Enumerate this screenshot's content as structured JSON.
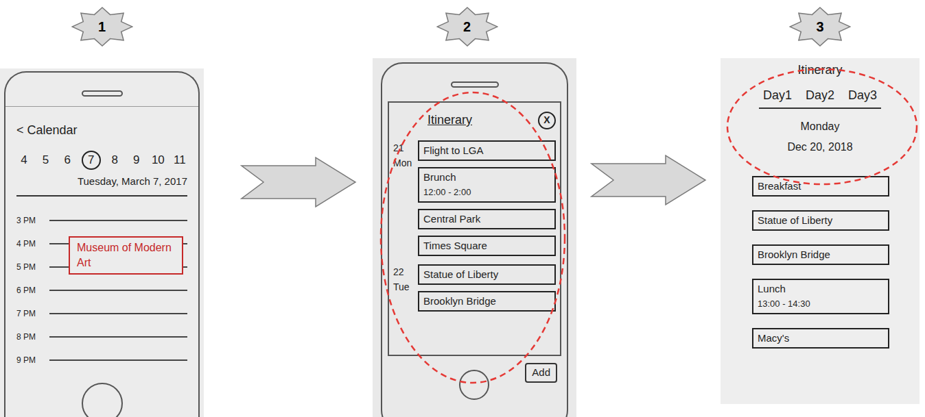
{
  "calendar_screen": {
    "badge": "1",
    "back": "< Calendar",
    "days": [
      {
        "label": "4",
        "selected": false
      },
      {
        "label": "5",
        "selected": false
      },
      {
        "label": "6",
        "selected": false
      },
      {
        "label": "7",
        "selected": true
      },
      {
        "label": "8",
        "selected": false
      },
      {
        "label": "9",
        "selected": false
      },
      {
        "label": "10",
        "selected": false
      },
      {
        "label": "11",
        "selected": false
      }
    ],
    "date": "Tuesday, March 7, 2017",
    "hours": [
      "3 PM",
      "4 PM",
      "5 PM",
      "6 PM",
      "7 PM",
      "8 PM",
      "9 PM"
    ],
    "event": {
      "title": "Museum of Modern Art",
      "starts_at": "4 PM",
      "ends_at": "5 PM",
      "color": "#c62828"
    }
  },
  "itinerary_list_screen": {
    "badge": "2",
    "title": "Itinerary",
    "close": "X",
    "days": [
      {
        "date": "21",
        "weekday": "Mon",
        "items": [
          {
            "title": "Flight to LGA",
            "time": ""
          },
          {
            "title": "Brunch",
            "time": "12:00 - 2:00"
          },
          {
            "title": "Central Park",
            "time": ""
          },
          {
            "title": "Times Square",
            "time": ""
          }
        ]
      },
      {
        "date": "22",
        "weekday": "Tue",
        "items": [
          {
            "title": "Statue of Liberty",
            "time": ""
          },
          {
            "title": "Brooklyn Bridge",
            "time": ""
          }
        ]
      }
    ],
    "add_button": "Add"
  },
  "itinerary_day_screen": {
    "badge": "3",
    "title": "Itinerary",
    "tabs": [
      {
        "label": "Day1"
      },
      {
        "label": "Day2"
      },
      {
        "label": "Day3"
      }
    ],
    "weekday": "Monday",
    "date": "Dec 20, 2018",
    "items": [
      {
        "title": "Breakfast",
        "time": ""
      },
      {
        "title": "Statue of Liberty",
        "time": ""
      },
      {
        "title": "Brooklyn Bridge",
        "time": ""
      },
      {
        "title": "Lunch",
        "time": "13:00 - 14:30"
      },
      {
        "title": "Macy's",
        "time": ""
      }
    ]
  }
}
